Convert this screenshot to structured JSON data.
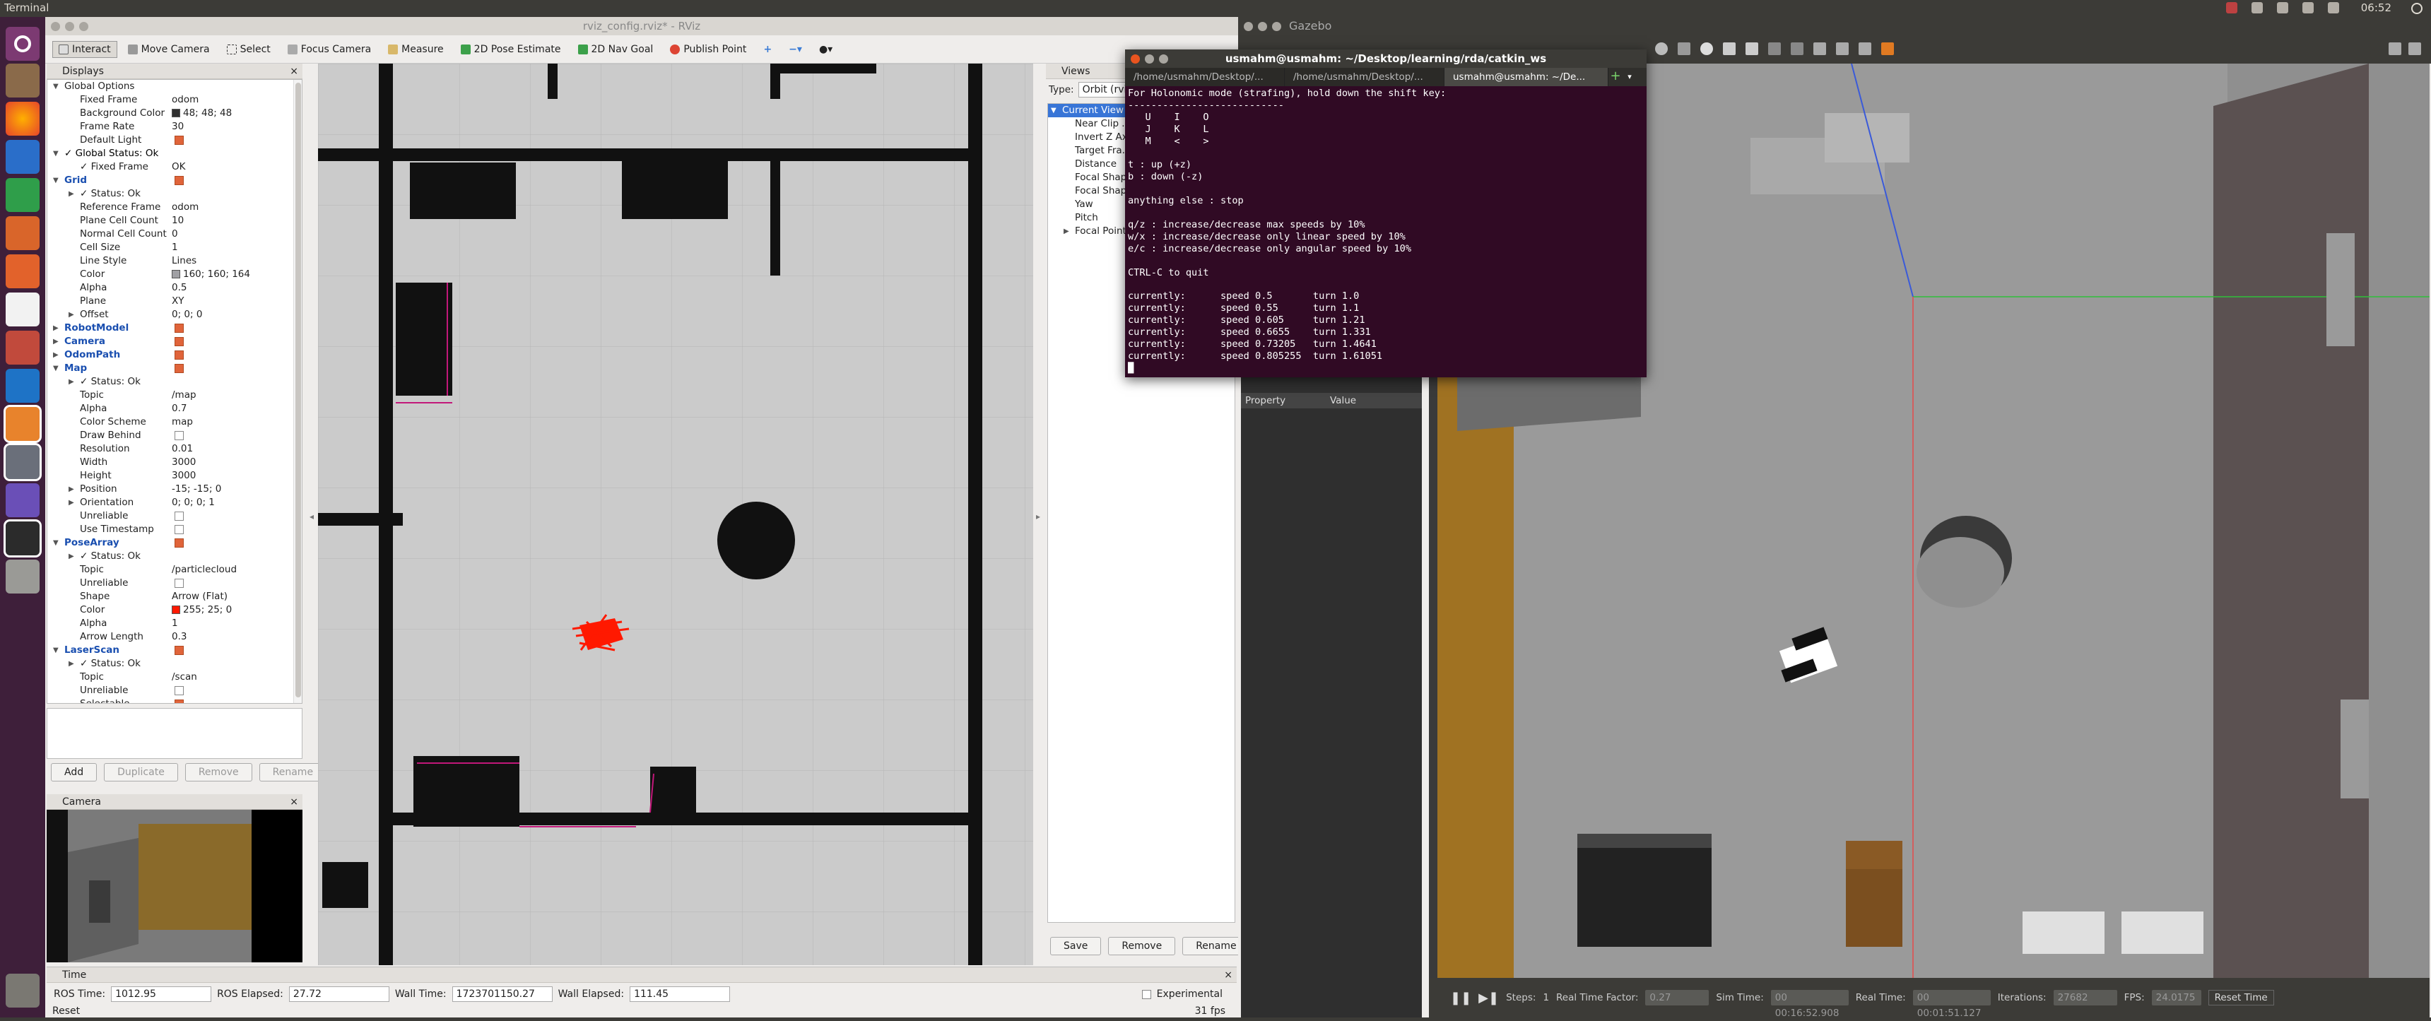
{
  "topbar": {
    "title": "Terminal",
    "clock": "06:52"
  },
  "rviz": {
    "window_title": "rviz_config.rviz* - RViz",
    "toolbar": [
      "Interact",
      "Move Camera",
      "Select",
      "Focus Camera",
      "Measure",
      "2D Pose Estimate",
      "2D Nav Goal",
      "Publish Point"
    ],
    "displays_title": "Displays",
    "displays": [
      {
        "k": "Global Options",
        "v": "",
        "d": 0,
        "exp": "open"
      },
      {
        "k": "Fixed Frame",
        "v": "odom",
        "d": 1
      },
      {
        "k": "Background Color",
        "v": "48; 48; 48",
        "d": 1,
        "color": "#303030"
      },
      {
        "k": "Frame Rate",
        "v": "30",
        "d": 1
      },
      {
        "k": "Default Light",
        "v": "",
        "d": 1,
        "cb": true
      },
      {
        "k": "Global Status: Ok",
        "v": "",
        "d": 0,
        "exp": "open",
        "check": true
      },
      {
        "k": "Fixed Frame",
        "v": "OK",
        "d": 1,
        "check": true
      },
      {
        "k": "Grid",
        "v": "",
        "d": 0,
        "exp": "open",
        "blue": true,
        "cb": true
      },
      {
        "k": "Status: Ok",
        "v": "",
        "d": 1,
        "exp": "closed",
        "check": true
      },
      {
        "k": "Reference Frame",
        "v": "odom",
        "d": 1
      },
      {
        "k": "Plane Cell Count",
        "v": "10",
        "d": 1
      },
      {
        "k": "Normal Cell Count",
        "v": "0",
        "d": 1
      },
      {
        "k": "Cell Size",
        "v": "1",
        "d": 1
      },
      {
        "k": "Line Style",
        "v": "Lines",
        "d": 1
      },
      {
        "k": "Color",
        "v": "160; 160; 164",
        "d": 1,
        "color": "#a0a0a4"
      },
      {
        "k": "Alpha",
        "v": "0.5",
        "d": 1
      },
      {
        "k": "Plane",
        "v": "XY",
        "d": 1
      },
      {
        "k": "Offset",
        "v": "0; 0; 0",
        "d": 1,
        "exp": "closed"
      },
      {
        "k": "RobotModel",
        "v": "",
        "d": 0,
        "exp": "closed",
        "blue": true,
        "cb": true
      },
      {
        "k": "Camera",
        "v": "",
        "d": 0,
        "exp": "closed",
        "blue": true,
        "cb": true
      },
      {
        "k": "OdomPath",
        "v": "",
        "d": 0,
        "exp": "closed",
        "blue": true,
        "cb": true
      },
      {
        "k": "Map",
        "v": "",
        "d": 0,
        "exp": "open",
        "blue": true,
        "cb": true
      },
      {
        "k": "Status: Ok",
        "v": "",
        "d": 1,
        "exp": "closed",
        "check": true
      },
      {
        "k": "Topic",
        "v": "/map",
        "d": 1
      },
      {
        "k": "Alpha",
        "v": "0.7",
        "d": 1
      },
      {
        "k": "Color Scheme",
        "v": "map",
        "d": 1
      },
      {
        "k": "Draw Behind",
        "v": "",
        "d": 1,
        "cbe": true
      },
      {
        "k": "Resolution",
        "v": "0.01",
        "d": 1
      },
      {
        "k": "Width",
        "v": "3000",
        "d": 1
      },
      {
        "k": "Height",
        "v": "3000",
        "d": 1
      },
      {
        "k": "Position",
        "v": "-15; -15; 0",
        "d": 1,
        "exp": "closed"
      },
      {
        "k": "Orientation",
        "v": "0; 0; 0; 1",
        "d": 1,
        "exp": "closed"
      },
      {
        "k": "Unreliable",
        "v": "",
        "d": 1,
        "cbe": true
      },
      {
        "k": "Use Timestamp",
        "v": "",
        "d": 1,
        "cbe": true
      },
      {
        "k": "PoseArray",
        "v": "",
        "d": 0,
        "exp": "open",
        "blue": true,
        "cb": true
      },
      {
        "k": "Status: Ok",
        "v": "",
        "d": 1,
        "exp": "closed",
        "check": true
      },
      {
        "k": "Topic",
        "v": "/particlecloud",
        "d": 1
      },
      {
        "k": "Unreliable",
        "v": "",
        "d": 1,
        "cbe": true
      },
      {
        "k": "Shape",
        "v": "Arrow (Flat)",
        "d": 1
      },
      {
        "k": "Color",
        "v": "255; 25; 0",
        "d": 1,
        "color": "#ff1900"
      },
      {
        "k": "Alpha",
        "v": "1",
        "d": 1
      },
      {
        "k": "Arrow Length",
        "v": "0.3",
        "d": 1
      },
      {
        "k": "LaserScan",
        "v": "",
        "d": 0,
        "exp": "open",
        "blue": true,
        "cb": true
      },
      {
        "k": "Status: Ok",
        "v": "",
        "d": 1,
        "exp": "closed",
        "check": true
      },
      {
        "k": "Topic",
        "v": "/scan",
        "d": 1
      },
      {
        "k": "Unreliable",
        "v": "",
        "d": 1,
        "cbe": true
      },
      {
        "k": "Selectable",
        "v": "",
        "d": 1,
        "cb": true
      }
    ],
    "buttons": {
      "add": "Add",
      "duplicate": "Duplicate",
      "remove": "Remove",
      "rename": "Rename"
    },
    "camera_title": "Camera",
    "views": {
      "title": "Views",
      "type_label": "Type:",
      "type_value": "Orbit (rviz)",
      "current_view": "Current View",
      "items": [
        "Near Clip ...",
        "Invert Z Axis",
        "Target Fra...",
        "Distance",
        "Focal Shape...",
        "Focal Shape...",
        "Yaw",
        "Pitch",
        "Focal Point"
      ],
      "save": "Save",
      "remove": "Remove",
      "rename": "Rename"
    },
    "time": {
      "title": "Time",
      "ros_time_label": "ROS Time:",
      "ros_time": "1012.95",
      "ros_elapsed_label": "ROS Elapsed:",
      "ros_elapsed": "27.72",
      "wall_time_label": "Wall Time:",
      "wall_time": "1723701150.27",
      "wall_elapsed_label": "Wall Elapsed:",
      "wall_elapsed": "111.45",
      "experimental": "Experimental",
      "reset": "Reset",
      "fps": "31 fps"
    }
  },
  "terminal": {
    "title": "usmahm@usmahm: ~/Desktop/learning/rda/catkin_ws",
    "tabs": [
      "/home/usmahm/Desktop/...",
      "/home/usmahm/Desktop/...",
      "usmahm@usmahm: ~/De..."
    ],
    "lines": [
      "For Holonomic mode (strafing), hold down the shift key:",
      "---------------------------",
      "   U    I    O",
      "   J    K    L",
      "   M    <    >",
      "",
      "t : up (+z)",
      "b : down (-z)",
      "",
      "anything else : stop",
      "",
      "q/z : increase/decrease max speeds by 10%",
      "w/x : increase/decrease only linear speed by 10%",
      "e/c : increase/decrease only angular speed by 10%",
      "",
      "CTRL-C to quit",
      "",
      "currently:      speed 0.5       turn 1.0",
      "currently:      speed 0.55      turn 1.1",
      "currently:      speed 0.605     turn 1.21",
      "currently:      speed 0.6655    turn 1.331",
      "currently:      speed 0.73205   turn 1.4641",
      "currently:      speed 0.805255  turn 1.61051"
    ]
  },
  "gazebo": {
    "window_title": "Gazebo",
    "property": "Property",
    "value": "Value",
    "steps_label": "Steps:",
    "steps": "1",
    "rtf_label": "Real Time Factor:",
    "rtf": "0.27",
    "sim_label": "Sim Time:",
    "sim": "00 00:16:52.908",
    "real_label": "Real Time:",
    "real": "00 00:01:51.127",
    "iter_label": "Iterations:",
    "iter": "27682",
    "fps_label": "FPS:",
    "fps": "24.0175",
    "reset_time": "Reset Time"
  }
}
